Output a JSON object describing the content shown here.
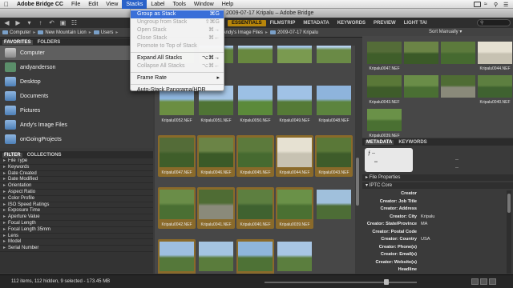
{
  "menubar": {
    "items": [
      "Adobe Bridge CC",
      "File",
      "Edit",
      "View",
      "Stacks",
      "Label",
      "Tools",
      "Window",
      "Help"
    ],
    "active_index": 4
  },
  "window": {
    "title": "2009-07-17 Kripalu – Adobe Bridge"
  },
  "toolbar": {
    "workspaces": [
      "ESSENTIALS",
      "FILMSTRIP",
      "METADATA",
      "KEYWORDS",
      "PREVIEW",
      "LIGHT TAI"
    ],
    "active_workspace": "ESSENTIALS"
  },
  "path_bar": {
    "crumbs": [
      "Computer",
      "New Mountain Lion",
      "Users",
      "Andy's Image Files",
      "2009-07-17 Kripalu"
    ],
    "sort_label": "Sort Manually"
  },
  "left_panel": {
    "tabs": [
      "FAVORITES",
      "FOLDERS"
    ],
    "favorites": [
      {
        "label": "Computer",
        "icon": "computer-icon",
        "selected": true
      },
      {
        "label": "andyanderson",
        "icon": "user-folder-icon",
        "selected": false
      },
      {
        "label": "Desktop",
        "icon": "folder-icon",
        "selected": false
      },
      {
        "label": "Documents",
        "icon": "folder-icon",
        "selected": false
      },
      {
        "label": "Pictures",
        "icon": "folder-icon",
        "selected": false
      },
      {
        "label": "Andy's Image Files",
        "icon": "folder-icon",
        "selected": false
      },
      {
        "label": "onGoingProjects",
        "icon": "folder-icon",
        "selected": false
      }
    ],
    "filter_tabs": [
      "FILTER",
      "COLLECTIONS"
    ],
    "filters": [
      "File Type",
      "Keywords",
      "Date Created",
      "Date Modified",
      "Orientation",
      "Aspect Ratio",
      "Color Profile",
      "ISO Speed Ratings",
      "Exposure Time",
      "Aperture Value",
      "Focal Length",
      "Focal Length 35mm",
      "Lens",
      "Model",
      "Serial Number"
    ]
  },
  "stacks_menu": {
    "items": [
      {
        "label": "Group as Stack",
        "shortcut": "⌘G",
        "state": "highlighted"
      },
      {
        "label": "Ungroup from Stack",
        "shortcut": "⇧⌘G",
        "state": "disabled"
      },
      {
        "label": "Open Stack",
        "shortcut": "⌘→",
        "state": "disabled"
      },
      {
        "label": "Close Stack",
        "shortcut": "⌘←",
        "state": "disabled"
      },
      {
        "label": "Promote to Top of Stack",
        "shortcut": "",
        "state": "disabled"
      },
      {
        "label": "Expand All Stacks",
        "shortcut": "⌥⌘→",
        "state": "normal"
      },
      {
        "label": "Collapse All Stacks",
        "shortcut": "⌥⌘←",
        "state": "disabled"
      },
      {
        "label": "Frame Rate",
        "shortcut": "▸",
        "state": "normal"
      },
      {
        "label": "Auto-Stack Panorama/HDR",
        "shortcut": "",
        "state": "normal"
      }
    ]
  },
  "content": {
    "thumbnails": [
      {
        "label": "",
        "tone": "#6f8f4a",
        "sky": "#9fc3e6",
        "selected": false
      },
      {
        "label": "",
        "tone": "#5f7f3c",
        "sky": "#a9c9ea",
        "selected": false
      },
      {
        "label": "",
        "tone": "#68883f",
        "sky": "#b2cfec",
        "selected": false
      },
      {
        "label": "",
        "tone": "#7a9a50",
        "sky": "#a2c4e8",
        "selected": false
      },
      {
        "label": "",
        "tone": "#6a8a46",
        "sky": "#b6d2ee",
        "selected": false
      },
      {
        "label": "Kripalu0052.NEF",
        "tone": "#6b8e42",
        "sky": "#8fb7e0",
        "selected": false
      },
      {
        "label": "Kripalu0051.NEF",
        "tone": "#4f7435",
        "sky": "#a6c6e6",
        "selected": false
      },
      {
        "label": "Kripalu0050.NEF",
        "tone": "#5b8a3a",
        "sky": "#9cc0e4",
        "selected": false
      },
      {
        "label": "Kripalu0049.NEF",
        "tone": "#557a36",
        "sky": "#a0c2e6",
        "selected": false
      },
      {
        "label": "Kripalu0048.NEF",
        "tone": "#5c843e",
        "sky": "#8eb4dc",
        "selected": false
      },
      {
        "label": "Kripalu0047.NEF",
        "tone": "#3f5e2a",
        "sky": "#546c38",
        "selected": true
      },
      {
        "label": "Kripalu0046.NEF",
        "tone": "#3b5a28",
        "sky": "#6b8446",
        "selected": true
      },
      {
        "label": "Kripalu0045.NEF",
        "tone": "#466a30",
        "sky": "#5c7a3c",
        "selected": true
      },
      {
        "label": "Kripalu0044.NEF",
        "tone": "#c7c2b2",
        "sky": "#e6e1d2",
        "selected": true
      },
      {
        "label": "Kripalu0043.NEF",
        "tone": "#3e5c2a",
        "sky": "#5a7838",
        "selected": true
      },
      {
        "label": "Kripalu0042.NEF",
        "tone": "#4a6f33",
        "sky": "#6a8d48",
        "selected": true
      },
      {
        "label": "Kripalu0041.NEF",
        "tone": "#8a8a7a",
        "sky": "#4f6c34",
        "selected": true
      },
      {
        "label": "Kripalu0040.NEF",
        "tone": "#3f6230",
        "sky": "#5d7f40",
        "selected": true
      },
      {
        "label": "Kripalu0039.NEF",
        "tone": "#4a7032",
        "sky": "#6a9148",
        "selected": true
      },
      {
        "label": "",
        "tone": "#4d6d36",
        "sky": "#a0c0dc",
        "selected": false
      },
      {
        "label": "",
        "tone": "#55783a",
        "sky": "#9ebfe0",
        "selected": true
      },
      {
        "label": "",
        "tone": "#5a7c3c",
        "sky": "#a4c4e2",
        "selected": false
      },
      {
        "label": "",
        "tone": "#4e7236",
        "sky": "#8fb6dc",
        "selected": true
      },
      {
        "label": "",
        "tone": "#5b7e3e",
        "sky": "#a8c6e4",
        "selected": false
      }
    ]
  },
  "preview": {
    "thumbnails": [
      {
        "label": "Kripalu0047.NEF",
        "tone": "#3f5e2a",
        "sky": "#546c38"
      },
      {
        "label": "",
        "tone": "#3b5a28",
        "sky": "#6b8446"
      },
      {
        "label": "",
        "tone": "#466a30",
        "sky": "#5c7a3c"
      },
      {
        "label": "Kripalu0044.NEF",
        "tone": "#c7c2b2",
        "sky": "#e6e1d2"
      },
      {
        "label": "Kripalu0043.NEF",
        "tone": "#3e5c2a",
        "sky": "#5a7838"
      },
      {
        "label": "",
        "tone": "#4a6f33",
        "sky": "#6a8d48"
      },
      {
        "label": "",
        "tone": "#8a8a7a",
        "sky": "#4f6c34"
      },
      {
        "label": "Kripalu0040.NEF",
        "tone": "#3f6230",
        "sky": "#5d7f40"
      },
      {
        "label": "Kripalu0039.NEF",
        "tone": "#4a7032",
        "sky": "#6a9148"
      }
    ]
  },
  "metadata_panel": {
    "tabs": [
      "METADATA",
      "KEYWORDS"
    ],
    "camera_aperture": "ƒ --",
    "camera_shutter": "--",
    "dash": "--",
    "file_properties_label": "File Properties",
    "iptc_label": "IPTC Core",
    "rows": [
      {
        "key": "Creator",
        "value": ""
      },
      {
        "key": "Creator: Job Title",
        "value": ""
      },
      {
        "key": "Creator: Address",
        "value": ""
      },
      {
        "key": "Creator: City",
        "value": "Kripalu"
      },
      {
        "key": "Creator: State/Province",
        "value": "MA"
      },
      {
        "key": "Creator: Postal Code",
        "value": ""
      },
      {
        "key": "Creator: Country",
        "value": "USA"
      },
      {
        "key": "Creator: Phone(s)",
        "value": ""
      },
      {
        "key": "Creator: Email(s)",
        "value": ""
      },
      {
        "key": "Creator: Website(s)",
        "value": ""
      },
      {
        "key": "Headline",
        "value": ""
      }
    ]
  },
  "status": {
    "text": "112 items, 112 hidden, 9 selected - 173.45 MB",
    "zoom_fraction": 0.8
  }
}
